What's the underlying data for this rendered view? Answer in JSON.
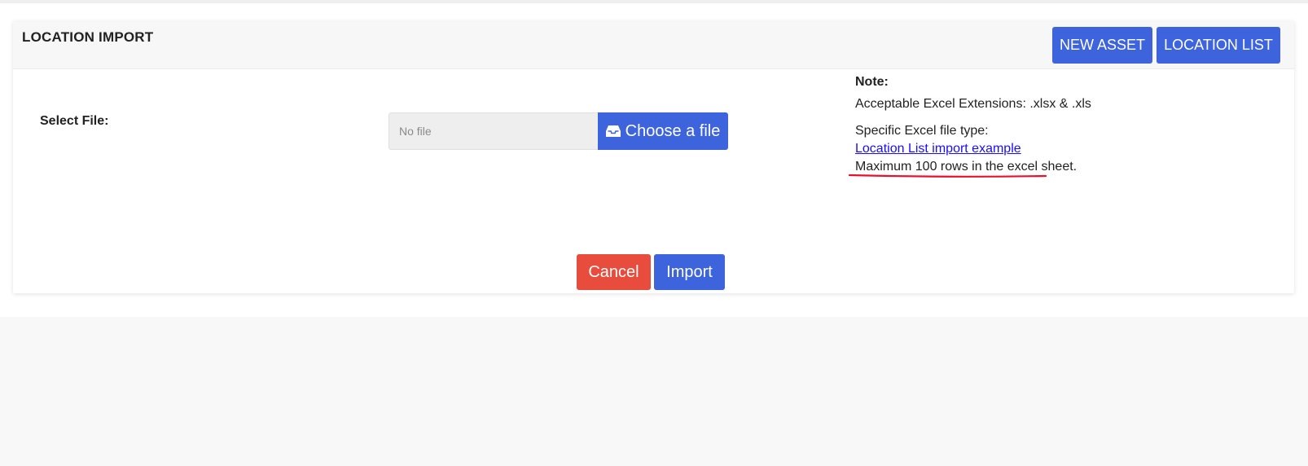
{
  "header": {
    "title": "LOCATION IMPORT",
    "new_asset_label": "NEW ASSET",
    "location_list_label": "LOCATION LIST"
  },
  "form": {
    "select_file_label": "Select File:",
    "file_placeholder": "No file",
    "choose_file_label": "Choose a file",
    "choose_file_icon": "inbox-icon"
  },
  "note": {
    "title": "Note:",
    "extensions": "Acceptable Excel Extensions: .xlsx & .xls",
    "file_type": "Specific Excel file type:",
    "example_link": "Location List import example",
    "max_rows": "Maximum 100 rows in the excel sheet."
  },
  "actions": {
    "cancel_label": "Cancel",
    "import_label": "Import"
  },
  "colors": {
    "primary": "#3d63dd",
    "danger": "#e74c3c",
    "link": "#1a0dff",
    "annotation": "#e8112d"
  }
}
